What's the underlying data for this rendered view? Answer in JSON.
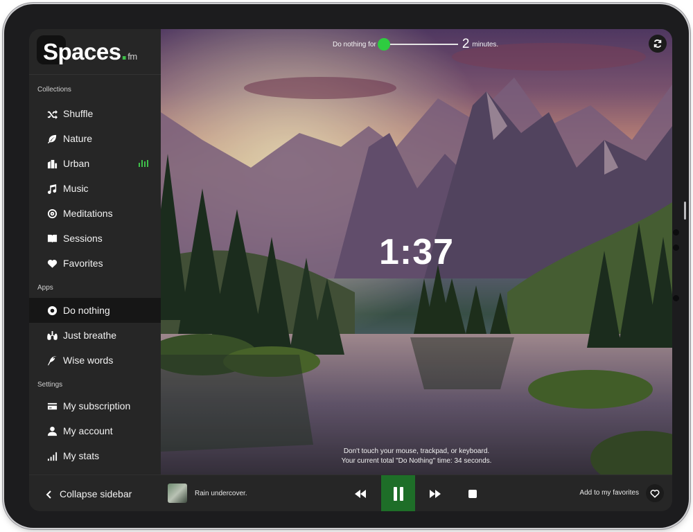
{
  "brand": {
    "name": "Spaces",
    "dot": ".",
    "suffix": "fm"
  },
  "sidebar": {
    "collections_label": "Collections",
    "collections": [
      {
        "label": "Shuffle",
        "icon": "shuffle-icon"
      },
      {
        "label": "Nature",
        "icon": "leaf-icon"
      },
      {
        "label": "Urban",
        "icon": "city-icon",
        "playing": true
      },
      {
        "label": "Music",
        "icon": "music-note-icon"
      },
      {
        "label": "Meditations",
        "icon": "target-icon"
      },
      {
        "label": "Sessions",
        "icon": "book-icon"
      },
      {
        "label": "Favorites",
        "icon": "heart-icon"
      }
    ],
    "apps_label": "Apps",
    "apps": [
      {
        "label": "Do nothing",
        "icon": "record-icon",
        "active": true
      },
      {
        "label": "Just breathe",
        "icon": "lungs-icon"
      },
      {
        "label": "Wise words",
        "icon": "feather-icon"
      }
    ],
    "settings_label": "Settings",
    "settings": [
      {
        "label": "My subscription",
        "icon": "credit-card-icon"
      },
      {
        "label": "My account",
        "icon": "user-icon"
      },
      {
        "label": "My stats",
        "icon": "signal-bars-icon"
      }
    ]
  },
  "timer": {
    "prefix": "Do nothing for",
    "minutes": "2",
    "suffix": "minutes.",
    "countdown": "1:37"
  },
  "hint": {
    "line1": "Don't touch your mouse, trackpad, or keyboard.",
    "line2": "Your current total \"Do Nothing\" time: 34 seconds."
  },
  "player": {
    "collapse_label": "Collapse sidebar",
    "track_title": "Rain undercover.",
    "favorite_label": "Add to my favorites"
  },
  "colors": {
    "accent": "#2ecc40",
    "pause_bg": "#1e6e28",
    "sidebar_bg": "#262626"
  }
}
